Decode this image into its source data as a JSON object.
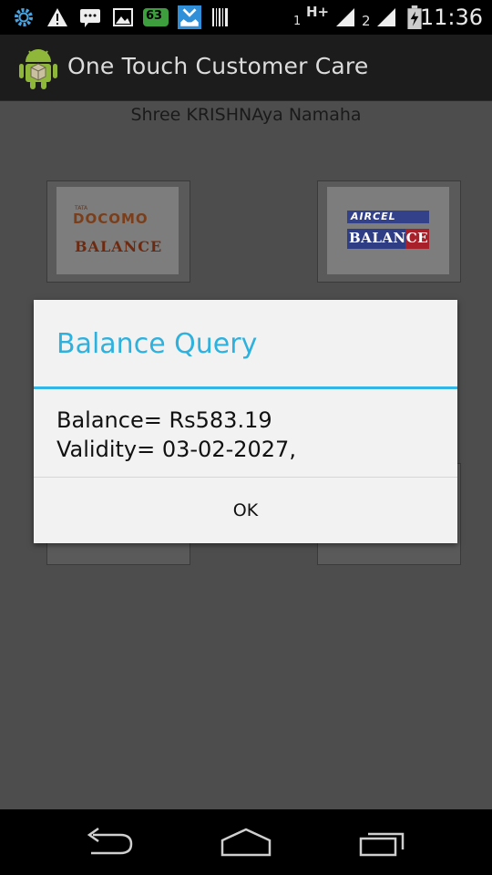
{
  "status_bar": {
    "notification_badge": "63",
    "sim1_label": "1",
    "network_type": "H+",
    "sim2_label": "2",
    "time": "11:36"
  },
  "action_bar": {
    "app_title": "One Touch Customer Care",
    "app_icon": "android-icon"
  },
  "content": {
    "subtitle": "Shree KRISHNAya Namaha",
    "tiles": [
      {
        "brand_small": "TATA",
        "brand": "DOCOMO",
        "label": "BALANCE"
      },
      {
        "brand": "AIRCEL",
        "label": "BALANCE"
      }
    ]
  },
  "dialog": {
    "title": "Balance Query",
    "message_line1": "Balance= Rs583.19",
    "message_line2": "Validity= 03-02-2027,",
    "ok_label": "OK",
    "accent_color": "#33b5e5"
  },
  "nav_bar": {
    "back_icon": "back-icon",
    "home_icon": "home-icon",
    "recents_icon": "recents-icon"
  }
}
